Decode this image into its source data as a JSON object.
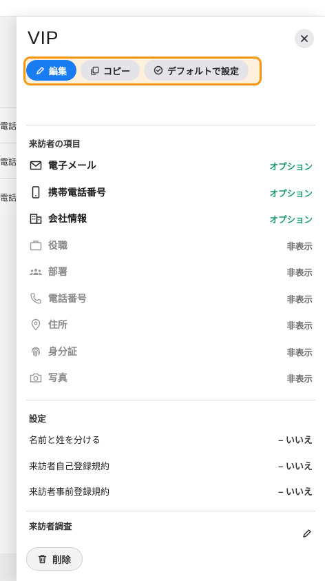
{
  "background": {
    "row_labels": [
      "電話",
      "電話",
      "電話"
    ]
  },
  "panel": {
    "title": "VIP",
    "actions": {
      "edit": "編集",
      "copy": "コピー",
      "set_default": "デフォルトで設定"
    },
    "visitor_fields": {
      "section_title": "来訪者の項目",
      "items": [
        {
          "label": "電子メール",
          "status": "オプション",
          "icon": "mail-icon",
          "enabled": true
        },
        {
          "label": "携帯電話番号",
          "status": "オプション",
          "icon": "mobile-phone-icon",
          "enabled": true
        },
        {
          "label": "会社情報",
          "status": "オプション",
          "icon": "building-icon",
          "enabled": true
        },
        {
          "label": "役職",
          "status": "非表示",
          "icon": "briefcase-icon",
          "enabled": false
        },
        {
          "label": "部署",
          "status": "非表示",
          "icon": "team-icon",
          "enabled": false
        },
        {
          "label": "電話番号",
          "status": "非表示",
          "icon": "phone-icon",
          "enabled": false
        },
        {
          "label": "住所",
          "status": "非表示",
          "icon": "location-pin-icon",
          "enabled": false
        },
        {
          "label": "身分証",
          "status": "非表示",
          "icon": "fingerprint-icon",
          "enabled": false
        },
        {
          "label": "写真",
          "status": "非表示",
          "icon": "camera-icon",
          "enabled": false
        }
      ]
    },
    "settings": {
      "section_title": "設定",
      "items": [
        {
          "label": "名前と姓を分ける",
          "value": "– いいえ"
        },
        {
          "label": "来訪者自己登録規約",
          "value": "– いいえ"
        },
        {
          "label": "来訪者事前登録規約",
          "value": "– いいえ"
        }
      ]
    },
    "survey": {
      "section_title": "来訪者調査"
    },
    "delete_label": "削除"
  },
  "colors": {
    "accent": "#1a7cf2",
    "highlight": "#f5960e",
    "status_optional": "#1c9a6c"
  }
}
